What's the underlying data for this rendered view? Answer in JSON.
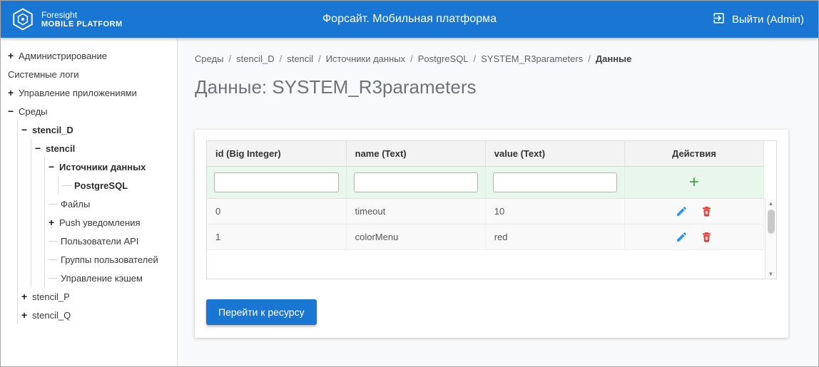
{
  "header": {
    "logo_line1": "Foresight",
    "logo_line2": "MOBILE PLATFORM",
    "app_title": "Форсайт. Мобильная платформа",
    "logout_label": "Выйти (Admin)"
  },
  "sidebar": {
    "items": [
      {
        "label": "Администрирование",
        "expander": "plus"
      },
      {
        "label": "Системные логи",
        "expander": "none"
      },
      {
        "label": "Управление приложениями",
        "expander": "plus"
      },
      {
        "label": "Среды",
        "expander": "minus"
      },
      {
        "label": "stencil_D",
        "expander": "minus"
      },
      {
        "label": "stencil",
        "expander": "minus"
      },
      {
        "label": "Источники данных",
        "expander": "minus"
      },
      {
        "label": "PostgreSQL",
        "expander": "leaf"
      },
      {
        "label": "Файлы",
        "expander": "leaf"
      },
      {
        "label": "Push уведомления",
        "expander": "plus"
      },
      {
        "label": "Пользователи API",
        "expander": "leaf"
      },
      {
        "label": "Группы пользователей",
        "expander": "leaf"
      },
      {
        "label": "Управление кэшем",
        "expander": "leaf"
      },
      {
        "label": "stencil_P",
        "expander": "plus"
      },
      {
        "label": "stencil_Q",
        "expander": "plus"
      }
    ]
  },
  "breadcrumb": {
    "items": [
      "Среды",
      "stencil_D",
      "stencil",
      "Источники данных",
      "PostgreSQL",
      "SYSTEM_R3parameters",
      "Данные"
    ]
  },
  "page": {
    "title": "Данные: SYSTEM_R3parameters"
  },
  "table": {
    "columns": [
      "id (Big Integer)",
      "name (Text)",
      "value (Text)",
      "Действия"
    ],
    "filter": {
      "id": "",
      "name": "",
      "value": ""
    },
    "add_button_label": "+",
    "rows": [
      {
        "id": "0",
        "name": "timeout",
        "value": "10"
      },
      {
        "id": "1",
        "name": "colorMenu",
        "value": "red"
      }
    ]
  },
  "footer": {
    "go_to_resource_label": "Перейти к ресурсу"
  },
  "colors": {
    "header_blue": "#1976d2",
    "primary_button_blue": "#1976d2",
    "add_green": "#43a047",
    "edit_blue": "#2196f3",
    "delete_red": "#e53935",
    "filter_row_green": "#e9f6ec"
  }
}
